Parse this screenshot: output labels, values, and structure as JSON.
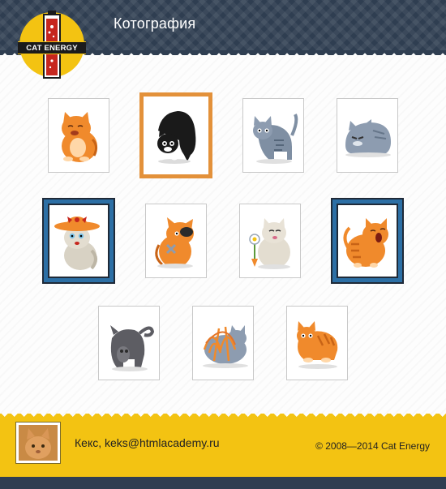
{
  "header": {
    "title": "Котография",
    "logo_text": "CAT ENERGY",
    "logo_color": "#f3c312",
    "background_color": "#2f3e51"
  },
  "gallery": {
    "rows": [
      [
        {
          "cat": "orange-cat-yawning-sitting",
          "selected": "none"
        },
        {
          "cat": "black-cat-bowing",
          "selected": "orange"
        },
        {
          "cat": "grey-cat-standing",
          "selected": "none"
        },
        {
          "cat": "grey-cat-lying-grumpy",
          "selected": "none"
        }
      ],
      [
        {
          "cat": "cream-cat-in-hat",
          "selected": "blue"
        },
        {
          "cat": "orange-pirate-cat",
          "selected": "none"
        },
        {
          "cat": "cream-cat-with-flower",
          "selected": "none"
        },
        {
          "cat": "orange-cat-screaming",
          "selected": "blue"
        }
      ],
      [
        {
          "cat": "grey-cat-rear-view",
          "selected": "none"
        },
        {
          "cat": "grey-cat-tangled-in-yarn",
          "selected": "none"
        },
        {
          "cat": "orange-cat-crouching",
          "selected": "none"
        }
      ]
    ],
    "selection_colors": {
      "orange": "#e3913a",
      "blue": "#2c6fa5"
    }
  },
  "footer": {
    "author": "Кекс, keks@htmlacademy.ru",
    "copyright": "© 2008—2014 Cat Energy",
    "avatar": "cat-photo-avatar",
    "background_color": "#f3c312"
  }
}
